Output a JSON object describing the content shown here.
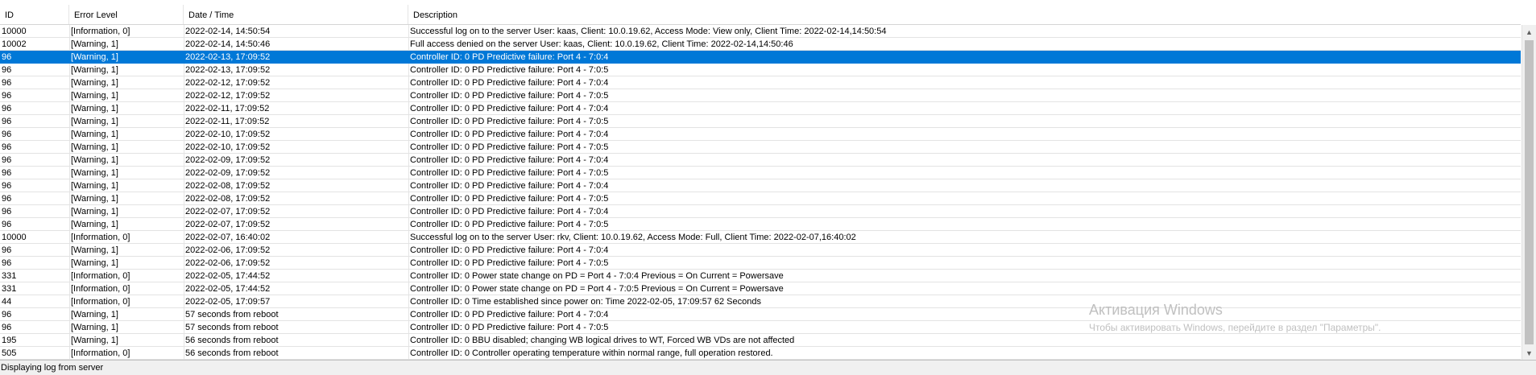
{
  "columns": {
    "id": "ID",
    "level": "Error Level",
    "datetime": "Date / Time",
    "description": "Description"
  },
  "rows": [
    {
      "id": "10000",
      "level": "[Information, 0]",
      "datetime": "2022-02-14, 14:50:54",
      "description": "Successful log on to the server User:  kaas, Client:  10.0.19.62,    Access Mode:  View only, Client Time:  2022-02-14,14:50:54"
    },
    {
      "id": "10002",
      "level": "[Warning, 1]",
      "datetime": "2022-02-14, 14:50:46",
      "description": "Full access denied on the server User:  kaas, Client:  10.0.19.62,    Client Time:  2022-02-14,14:50:46"
    },
    {
      "id": "96",
      "level": "[Warning, 1]",
      "datetime": "2022-02-13, 17:09:52",
      "description": "Controller ID:  0   PD Predictive failure:   Port 4 - 7:0:4",
      "selected": true
    },
    {
      "id": "96",
      "level": "[Warning, 1]",
      "datetime": "2022-02-13, 17:09:52",
      "description": "Controller ID:  0   PD Predictive failure:   Port 4 - 7:0:5"
    },
    {
      "id": "96",
      "level": "[Warning, 1]",
      "datetime": "2022-02-12, 17:09:52",
      "description": "Controller ID:  0   PD Predictive failure:   Port 4 - 7:0:4"
    },
    {
      "id": "96",
      "level": "[Warning, 1]",
      "datetime": "2022-02-12, 17:09:52",
      "description": "Controller ID:  0   PD Predictive failure:   Port 4 - 7:0:5"
    },
    {
      "id": "96",
      "level": "[Warning, 1]",
      "datetime": "2022-02-11, 17:09:52",
      "description": "Controller ID:  0   PD Predictive failure:   Port 4 - 7:0:4"
    },
    {
      "id": "96",
      "level": "[Warning, 1]",
      "datetime": "2022-02-11, 17:09:52",
      "description": "Controller ID:  0   PD Predictive failure:   Port 4 - 7:0:5"
    },
    {
      "id": "96",
      "level": "[Warning, 1]",
      "datetime": "2022-02-10, 17:09:52",
      "description": "Controller ID:  0   PD Predictive failure:   Port 4 - 7:0:4"
    },
    {
      "id": "96",
      "level": "[Warning, 1]",
      "datetime": "2022-02-10, 17:09:52",
      "description": "Controller ID:  0   PD Predictive failure:   Port 4 - 7:0:5"
    },
    {
      "id": "96",
      "level": "[Warning, 1]",
      "datetime": "2022-02-09, 17:09:52",
      "description": "Controller ID:  0   PD Predictive failure:   Port 4 - 7:0:4"
    },
    {
      "id": "96",
      "level": "[Warning, 1]",
      "datetime": "2022-02-09, 17:09:52",
      "description": "Controller ID:  0   PD Predictive failure:   Port 4 - 7:0:5"
    },
    {
      "id": "96",
      "level": "[Warning, 1]",
      "datetime": "2022-02-08, 17:09:52",
      "description": "Controller ID:  0   PD Predictive failure:   Port 4 - 7:0:4"
    },
    {
      "id": "96",
      "level": "[Warning, 1]",
      "datetime": "2022-02-08, 17:09:52",
      "description": "Controller ID:  0   PD Predictive failure:   Port 4 - 7:0:5"
    },
    {
      "id": "96",
      "level": "[Warning, 1]",
      "datetime": "2022-02-07, 17:09:52",
      "description": "Controller ID:  0   PD Predictive failure:   Port 4 - 7:0:4"
    },
    {
      "id": "96",
      "level": "[Warning, 1]",
      "datetime": "2022-02-07, 17:09:52",
      "description": "Controller ID:  0   PD Predictive failure:   Port 4 - 7:0:5"
    },
    {
      "id": "10000",
      "level": "[Information, 0]",
      "datetime": "2022-02-07, 16:40:02",
      "description": "Successful log on to the server User:  rkv, Client:  10.0.19.62,    Access Mode:  Full, Client Time:  2022-02-07,16:40:02"
    },
    {
      "id": "96",
      "level": "[Warning, 1]",
      "datetime": "2022-02-06, 17:09:52",
      "description": "Controller ID:  0   PD Predictive failure:   Port 4 - 7:0:4"
    },
    {
      "id": "96",
      "level": "[Warning, 1]",
      "datetime": "2022-02-06, 17:09:52",
      "description": "Controller ID:  0   PD Predictive failure:   Port 4 - 7:0:5"
    },
    {
      "id": "331",
      "level": "[Information, 0]",
      "datetime": "2022-02-05, 17:44:52",
      "description": "Controller ID:  0   Power state change on PD   =   Port 4 - 7:0:4  Previous   =   On  Current   =   Powersave"
    },
    {
      "id": "331",
      "level": "[Information, 0]",
      "datetime": "2022-02-05, 17:44:52",
      "description": "Controller ID:  0   Power state change on PD   =   Port 4 - 7:0:5  Previous   =   On  Current   =   Powersave"
    },
    {
      "id": "44",
      "level": "[Information, 0]",
      "datetime": "2022-02-05, 17:09:57",
      "description": "Controller ID:  0   Time established since power on:   Time   2022-02-05, 17:09:57     62  Seconds"
    },
    {
      "id": "96",
      "level": "[Warning, 1]",
      "datetime": "57  seconds from reboot",
      "description": "Controller ID:  0   PD Predictive failure:   Port 4 - 7:0:4"
    },
    {
      "id": "96",
      "level": "[Warning, 1]",
      "datetime": "57  seconds from reboot",
      "description": "Controller ID:  0   PD Predictive failure:   Port 4 - 7:0:5"
    },
    {
      "id": "195",
      "level": "[Warning, 1]",
      "datetime": "56  seconds from reboot",
      "description": "Controller ID:  0   BBU disabled; changing WB logical drives to WT, Forced WB VDs are not affected"
    },
    {
      "id": "505",
      "level": "[Information, 0]",
      "datetime": "56  seconds from reboot",
      "description": "Controller ID:  0   Controller operating temperature within normal range, full operation restored."
    }
  ],
  "watermark": {
    "title": "Активация Windows",
    "subtitle": "Чтобы активировать Windows, перейдите в раздел \"Параметры\"."
  },
  "status": {
    "text": "Displaying log from server"
  },
  "colors": {
    "selection": "#0078d7",
    "header_border": "#d5d5d5"
  }
}
